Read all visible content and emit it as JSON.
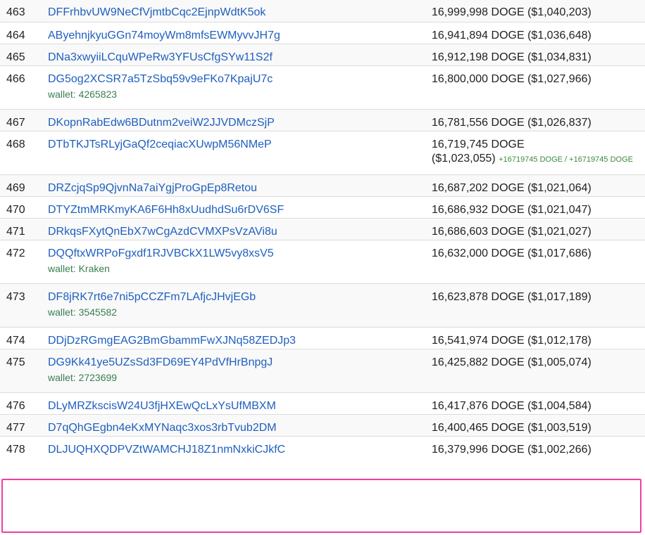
{
  "rows": [
    {
      "rank": "463",
      "address": "DFFrhbvUW9NeCfVjmtbCqc2EjnpWdtK5ok",
      "balance": "16,999,998 DOGE ($1,040,203)"
    },
    {
      "rank": "464",
      "address": "AByehnjkyuGGn74moyWm8mfsEWMyvvJH7g",
      "balance": "16,941,894 DOGE ($1,036,648)"
    },
    {
      "rank": "465",
      "address": "DNa3xwyiiLCquWPeRw3YFUsCfgSYw11S2f",
      "balance": "16,912,198 DOGE ($1,034,831)"
    },
    {
      "rank": "466",
      "address": "DG5og2XCSR7a5TzSbq59v9eFKo7KpajU7c",
      "wallet": "wallet: 4265823",
      "balance": "16,800,000 DOGE ($1,027,966)"
    },
    {
      "rank": "467",
      "address": "DKopnRabEdw6BDutnm2veiW2JJVDMczSjP",
      "balance": "16,781,556 DOGE ($1,026,837)"
    },
    {
      "rank": "468",
      "address": "DTbTKJTsRLyjGaQf2ceqiacXUwpM56NMeP",
      "balance_line1": "16,719,745 DOGE",
      "balance_line2": "($1,023,055)",
      "balance_delta": "+16719745 DOGE / +16719745 DOGE"
    },
    {
      "rank": "469",
      "address": "DRZcjqSp9QjvnNa7aiYgjProGpEp8Retou",
      "balance": "16,687,202 DOGE ($1,021,064)"
    },
    {
      "rank": "470",
      "address": "DTYZtmMRKmyKA6F6Hh8xUudhdSu6rDV6SF",
      "balance": "16,686,932 DOGE ($1,021,047)"
    },
    {
      "rank": "471",
      "address": "DRkqsFXytQnEbX7wCgAzdCVMXPsVzAVi8u",
      "balance": "16,686,603 DOGE ($1,021,027)"
    },
    {
      "rank": "472",
      "address": "DQQftxWRPoFgxdf1RJVBCkX1LW5vy8xsV5",
      "wallet": "wallet: Kraken",
      "balance": "16,632,000 DOGE ($1,017,686)"
    },
    {
      "rank": "473",
      "address": "DF8jRK7rt6e7ni5pCCZFm7LAfjcJHvjEGb",
      "wallet": "wallet: 3545582",
      "balance": "16,623,878 DOGE ($1,017,189)"
    },
    {
      "rank": "474",
      "address": "DDjDzRGmgEAG2BmGbammFwXJNq58ZEDJp3",
      "balance": "16,541,974 DOGE ($1,012,178)"
    },
    {
      "rank": "475",
      "address": "DG9Kk41ye5UZsSd3FD69EY4PdVfHrBnpgJ",
      "wallet": "wallet: 2723699",
      "balance": "16,425,882 DOGE ($1,005,074)"
    },
    {
      "rank": "476",
      "address": "DLyMRZkscisW24U3fjHXEwQcLxYsUfMBXM",
      "balance": "16,417,876 DOGE ($1,004,584)"
    },
    {
      "rank": "477",
      "address": "D7qQhGEgbn4eKxMYNaqc3xos3rbTvub2DM",
      "balance": "16,400,465 DOGE ($1,003,519)"
    },
    {
      "rank": "478",
      "address": "DLJUQHXQDPVZtWAMCHJ18Z1nmNxkiCJkfC",
      "balance": "16,379,996 DOGE ($1,002,266)"
    }
  ],
  "colors": {
    "link": "#1f5fbf",
    "wallet": "#3a7d52",
    "delta": "#3a8a3a",
    "highlight": "#ee3ea3",
    "row_alt": "#f9f9f9",
    "border": "#dcdcdc"
  }
}
